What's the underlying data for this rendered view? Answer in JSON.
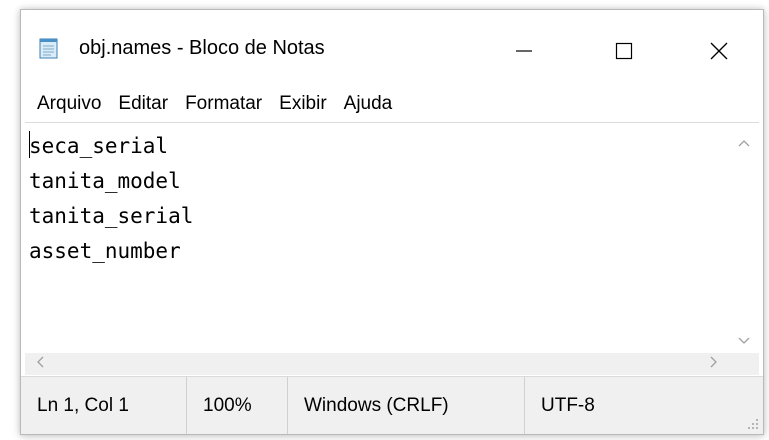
{
  "window": {
    "title": "obj.names - Bloco de Notas",
    "icon": "notepad-icon",
    "controls": {
      "minimize_icon": "minimize-icon",
      "maximize_icon": "maximize-icon",
      "close_icon": "close-icon"
    }
  },
  "menu": {
    "items": [
      {
        "label": "Arquivo"
      },
      {
        "label": "Editar"
      },
      {
        "label": "Formatar"
      },
      {
        "label": "Exibir"
      },
      {
        "label": "Ajuda"
      }
    ]
  },
  "editor": {
    "lines": [
      "seca_serial",
      "tanita_model",
      "tanita_serial",
      "asset_number"
    ]
  },
  "statusbar": {
    "position": "Ln 1, Col 1",
    "zoom": "100%",
    "line_ending": "Windows (CRLF)",
    "encoding": "UTF-8"
  },
  "colors": {
    "window_bg": "#ffffff",
    "statusbar_bg": "#f0f0f0",
    "border": "#dadada",
    "scroll_arrow": "#a0a0a0",
    "text": "#000000"
  }
}
